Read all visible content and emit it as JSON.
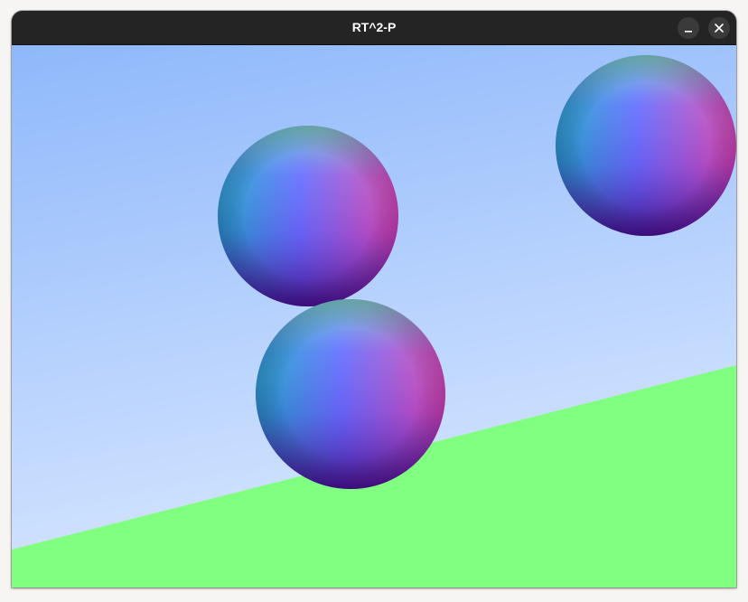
{
  "window": {
    "title": "RT^2-P"
  },
  "controls": {
    "minimize_icon": "minimize-icon",
    "close_icon": "close-icon"
  },
  "scene": {
    "sky_top_color": "#8fb8fb",
    "sky_bottom_color": "#d6e6ff",
    "ground_color": "#80ff80"
  }
}
